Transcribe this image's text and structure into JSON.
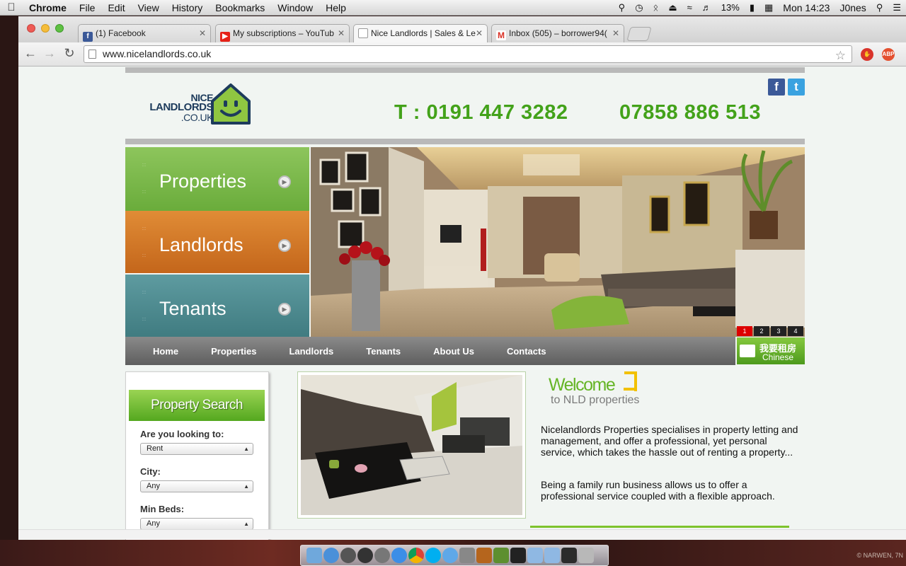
{
  "menubar": {
    "app": "Chrome",
    "items": [
      "File",
      "Edit",
      "View",
      "History",
      "Bookmarks",
      "Window",
      "Help"
    ],
    "battery": "13%",
    "clock": "Mon 14:23",
    "user": "J0nes"
  },
  "browser": {
    "tabs": [
      {
        "title": "(1) Facebook",
        "favicon": "facebook-icon"
      },
      {
        "title": "My subscriptions – YouTub",
        "favicon": "youtube-icon"
      },
      {
        "title": "Nice Landlords | Sales & Le",
        "favicon": "page-icon"
      },
      {
        "title": "Inbox (505) – borrower94(",
        "favicon": "gmail-icon"
      }
    ],
    "url": "www.nicelandlords.co.uk",
    "extensions": [
      "stop-icon",
      "adblock-icon"
    ],
    "ext_abp_label": "ABP"
  },
  "site": {
    "logo": {
      "line1": "NICE",
      "line2": "LANDLORDS",
      "line3": ".CO.UK"
    },
    "social": {
      "facebook": "f",
      "twitter": "t"
    },
    "phone1": "T : 0191 447 3282",
    "phone2": "07858 886 513",
    "tiles": [
      {
        "label": "Properties",
        "color": "#7cb84a"
      },
      {
        "label": "Landlords",
        "color": "#d57a25"
      },
      {
        "label": "Tenants",
        "color": "#4e8a8e"
      }
    ],
    "slider_pages": [
      "1",
      "2",
      "3",
      "4"
    ],
    "nav": [
      "Home",
      "Properties",
      "Landlords",
      "Tenants",
      "About Us",
      "Contacts"
    ],
    "chinese": {
      "line1": "我要租房",
      "line2": "Chinese"
    },
    "search": {
      "title": "Property Search",
      "fields": [
        {
          "label": "Are you looking to:",
          "value": "Rent"
        },
        {
          "label": "City:",
          "value": "Any"
        },
        {
          "label": "Min Beds:",
          "value": "Any"
        }
      ]
    },
    "welcome": {
      "title": "Welcome",
      "subtitle": "to NLD properties",
      "para1": "Nicelandlords Properties specialises in property letting and management, and offer a professional, yet personal service, which takes the hassle out of renting a property...",
      "para2": "Being a family run business allows us to offer a professional service coupled with a flexible approach."
    }
  },
  "desktop": {
    "copyright": "© NARWEN, 7N"
  }
}
